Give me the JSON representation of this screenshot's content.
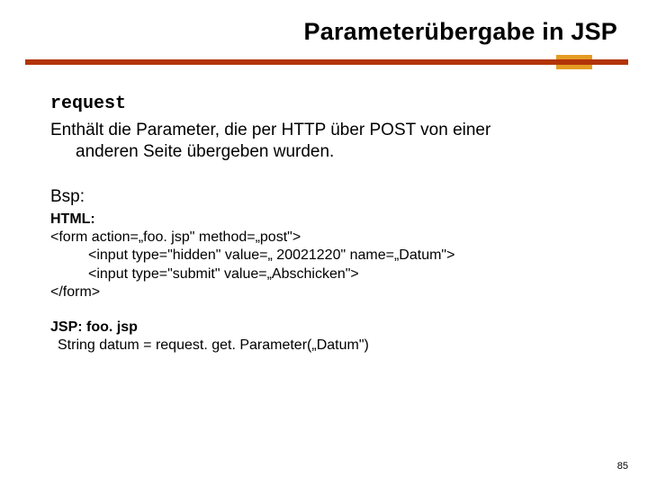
{
  "slide": {
    "title": "Parameterübergabe in JSP",
    "page_number": "85"
  },
  "content": {
    "keyword": "request",
    "description_line1": "Enthält die Parameter, die per HTTP über POST von einer",
    "description_line2": "anderen Seite übergeben wurden.",
    "example_label": "Bsp:",
    "html_label": "HTML:",
    "html_code": {
      "l1": "<form action=„foo. jsp\" method=„post\">",
      "l2": "<input type=\"hidden\" value=„ 20021220\" name=„Datum\">",
      "l3": "<input type=\"submit\" value=„Abschicken\">",
      "l4": "</form>"
    },
    "jsp_label": "JSP:   foo. jsp",
    "jsp_code": "String datum = request. get. Parameter(„Datum\")"
  }
}
